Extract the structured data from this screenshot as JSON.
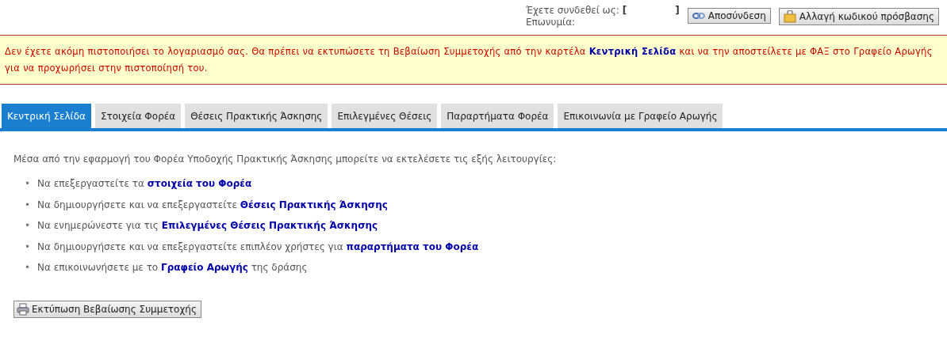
{
  "header": {
    "logged_in_label": "Έχετε συνδεθεί ως:",
    "bracket_open": "[",
    "bracket_close": "]",
    "name_label": "Επωνυμία:",
    "buttons": [
      {
        "kind": "logout",
        "label": "Αποσύνδεση"
      },
      {
        "kind": "password",
        "label": "Αλλαγή κωδικού πρόσβασης"
      }
    ]
  },
  "alert": {
    "before": "Δεν έχετε ακόμη πιστοποιήσει το λογαριασμό σας. Θα πρέπει να εκτυπώσετε τη Βεβαίωση Συμμετοχής από την καρτέλα",
    "link": "Κεντρική Σελίδα",
    "after": "και να την αποστείλετε με ΦΑΞ στο Γραφείο Αρωγής για να προχωρήσει στην πιστοποίησή του."
  },
  "tabs": [
    {
      "label": "Κεντρική Σελίδα",
      "selected": true
    },
    {
      "label": "Στοιχεία Φορέα",
      "selected": false
    },
    {
      "label": "Θέσεις Πρακτικής Άσκησης",
      "selected": false
    },
    {
      "label": "Επιλεγμένες Θέσεις",
      "selected": false
    },
    {
      "label": "Παραρτήματα Φορέα",
      "selected": false
    },
    {
      "label": "Επικοινωνία με Γραφείο Αρωγής",
      "selected": false
    }
  ],
  "intro": "Μέσα από την εφαρμογή του Φορέα Υποδοχής Πρακτικής Άσκησης μπορείτε να εκτελέσετε τις εξής λειτουργίες:",
  "bullet": "•",
  "functions": [
    {
      "text": "Να επεξεργαστείτε τα",
      "link": "στοιχεία του Φορέα"
    },
    {
      "text": "Να δημιουργήσετε και να επεξεργαστείτε",
      "link": "Θέσεις Πρακτικής Άσκησης"
    },
    {
      "text": "Να ενημερώνεστε για τις",
      "link": "Επιλεγμένες Θέσεις Πρακτικής Άσκησης"
    },
    {
      "text": "Να δημιουργήσετε και να επεξεργαστείτε επιπλέον χρήστες για",
      "link": "παραρτήματα του Φορέα"
    },
    {
      "text": "Να επικοινωνήσετε με το",
      "link": "Γραφείο Αρωγής",
      "after": "της δράσης"
    }
  ],
  "print_button": "Εκτύπωση Βεβαίωσης Συμμετοχής"
}
